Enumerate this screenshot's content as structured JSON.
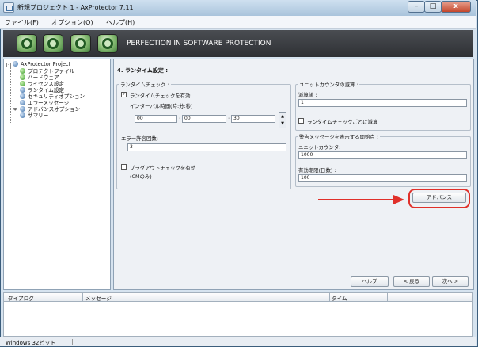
{
  "window": {
    "title": "新規プロジェクト 1 - AxProtector 7.11",
    "close_glyph": "x",
    "min_glyph": "–",
    "max_glyph": "□"
  },
  "menu": [
    "ファイル(F)",
    "オプション(O)",
    "ヘルプ(H)"
  ],
  "banner": {
    "text": "PERFECTION IN SOFTWARE PROTECTION"
  },
  "tree": {
    "root": "AxProtector Project",
    "items": [
      {
        "label": "プロテクトファイル",
        "icon": "green-check-icon"
      },
      {
        "label": "ハードウェア",
        "icon": "green-check-icon"
      },
      {
        "label": "ライセンス設定",
        "icon": "green-check-icon"
      },
      {
        "label": "ランタイム設定",
        "icon": "blue-globe-icon"
      },
      {
        "label": "セキュリティオプション",
        "icon": "blue-globe-icon"
      },
      {
        "label": "エラーメッセージ",
        "icon": "blue-globe-icon"
      },
      {
        "label": "アドバンスオプション",
        "icon": "blue-globe-icon"
      },
      {
        "label": "サマリー",
        "icon": "blue-globe-icon"
      }
    ]
  },
  "page": {
    "section_title": "4. ランタイム設定 :",
    "runtime_check": {
      "group_label": "ランタイムチェック :",
      "enable_label": "ランタイムチェックを有効",
      "enable_checked": true,
      "interval_label": "インターバル時間(時:分:秒)",
      "hours": "00",
      "minutes": "00",
      "seconds": "30",
      "error_limit_label": "エラー許容回数:",
      "error_limit_value": "3",
      "plugout_label": "プラグアウトチェックを有効",
      "plugout_note": "(CMのみ)",
      "plugout_checked": false
    },
    "unit_counter": {
      "group_label": "ユニットカウンタの減算 :",
      "decrement_label": "減算値 :",
      "decrement_value": "1",
      "per_check_label": "ランタイムチェックごとに減算",
      "per_check_checked": false
    },
    "warning": {
      "group_label": "警告メッセージを表示する開始点 :",
      "unit_counter_label": "ユニットカウンタ:",
      "unit_counter_value": "1000",
      "expiry_label": "有効期限(日数) :",
      "expiry_value": "100"
    },
    "advanced_button": "アドバンス",
    "nav": {
      "help": "ヘルプ",
      "back": "< 戻る",
      "next": "次へ >"
    }
  },
  "log": {
    "columns": [
      "ダイアログ",
      "メッセージ",
      "タイム"
    ]
  },
  "status": {
    "text": "Windows 32ビット"
  },
  "colors": {
    "highlight": "#e0302a",
    "banner": "#3a3c40"
  }
}
